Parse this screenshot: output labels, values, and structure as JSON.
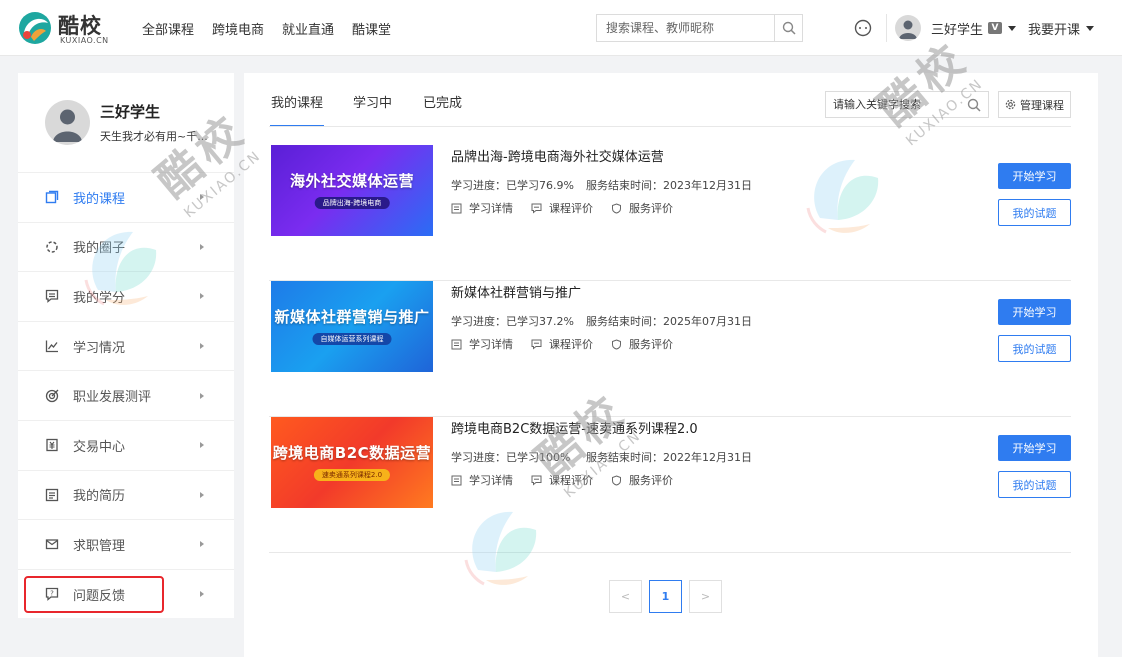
{
  "brand": {
    "name_cn": "酷校",
    "name_en": "KUXIAO.CN"
  },
  "nav": {
    "links": [
      "全部课程",
      "跨境电商",
      "就业直通",
      "酷课堂"
    ]
  },
  "search": {
    "placeholder": "搜索课程、教师昵称"
  },
  "user": {
    "name": "三好学生",
    "vip_badge": "V",
    "motto": "天生我才必有用~千..."
  },
  "teach_label": "我要开课",
  "sidebar": {
    "items": [
      {
        "label": "我的课程",
        "icon": "book-icon"
      },
      {
        "label": "我的圈子",
        "icon": "circle-icon"
      },
      {
        "label": "我的学分",
        "icon": "credit-icon"
      },
      {
        "label": "学习情况",
        "icon": "chart-icon"
      },
      {
        "label": "职业发展测评",
        "icon": "target-icon"
      },
      {
        "label": "交易中心",
        "icon": "transaction-icon"
      },
      {
        "label": "我的简历",
        "icon": "resume-icon"
      },
      {
        "label": "求职管理",
        "icon": "mail-icon"
      },
      {
        "label": "问题反馈",
        "icon": "feedback-icon"
      }
    ]
  },
  "tabs": [
    "我的课程",
    "学习中",
    "已完成"
  ],
  "course_search": {
    "placeholder": "请输入关键字搜索"
  },
  "manage_label": "管理课程",
  "course_labels": {
    "progress_prefix": "学习进度：",
    "end_prefix": "服务结束时间：",
    "detail": "学习详情",
    "course_review": "课程评价",
    "service_review": "服务评价",
    "start": "开始学习",
    "exam": "我的试题"
  },
  "courses": [
    {
      "title": "品牌出海-跨境电商海外社交媒体运营",
      "progress": "已学习76.9%",
      "end_date": "2023年12月31日",
      "thumb_title": "海外社交媒体运营",
      "thumb_sub": "品牌出海-跨境电商"
    },
    {
      "title": "新媒体社群营销与推广",
      "progress": "已学习37.2%",
      "end_date": "2025年07月31日",
      "thumb_title": "新媒体社群营销与推广",
      "thumb_sub": "自媒体运营系列课程"
    },
    {
      "title": "跨境电商B2C数据运营-速卖通系列课程2.0",
      "progress": "已学习100%",
      "end_date": "2022年12月31日",
      "thumb_title": "跨境电商B2C数据运营",
      "thumb_sub": "速卖通系列课程2.0"
    }
  ],
  "pagination": {
    "prev": "<",
    "current": "1",
    "next": ">"
  },
  "watermark": {
    "cn": "酷校",
    "en": "KUXIAO.CN"
  },
  "colors": {
    "accent": "#2f7cf0",
    "highlight_box": "#e8262c"
  }
}
